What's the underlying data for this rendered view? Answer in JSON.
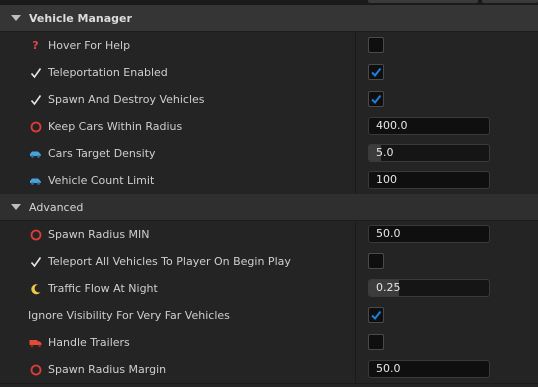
{
  "sections": {
    "vehicle_manager": "Vehicle Manager",
    "advanced": "Advanced"
  },
  "rows": {
    "hover_for_help": {
      "label": "Hover For Help",
      "checked": false
    },
    "teleportation_enabled": {
      "label": "Teleportation Enabled",
      "checked": true
    },
    "spawn_and_destroy": {
      "label": "Spawn And Destroy Vehicles",
      "checked": true
    },
    "keep_cars_within_radius": {
      "label": "Keep Cars Within Radius",
      "value": "400.0"
    },
    "cars_target_density": {
      "label": "Cars Target Density",
      "value": "5.0",
      "fill": 0.1
    },
    "vehicle_count_limit": {
      "label": "Vehicle Count Limit",
      "value": "100"
    },
    "spawn_radius_min": {
      "label": "Spawn Radius MIN",
      "value": "50.0"
    },
    "teleport_all_on_begin_play": {
      "label": "Teleport All Vehicles To Player On Begin Play",
      "checked": false
    },
    "traffic_flow_at_night": {
      "label": "Traffic Flow At Night",
      "value": "0.25",
      "fill": 0.25
    },
    "ignore_visibility_far": {
      "label": "Ignore Visibility For Very Far Vehicles",
      "checked": true
    },
    "handle_trailers": {
      "label": "Handle Trailers",
      "checked": false
    },
    "spawn_radius_margin": {
      "label": "Spawn Radius Margin",
      "value": "50.0"
    }
  },
  "colors": {
    "accent": "#1e7ee0",
    "help_icon": "#e04646",
    "radius_icon": "#e03a3a",
    "car_icon": "#4aa3e0",
    "moon_icon": "#f0c64a",
    "truck_icon": "#e24a3a"
  }
}
